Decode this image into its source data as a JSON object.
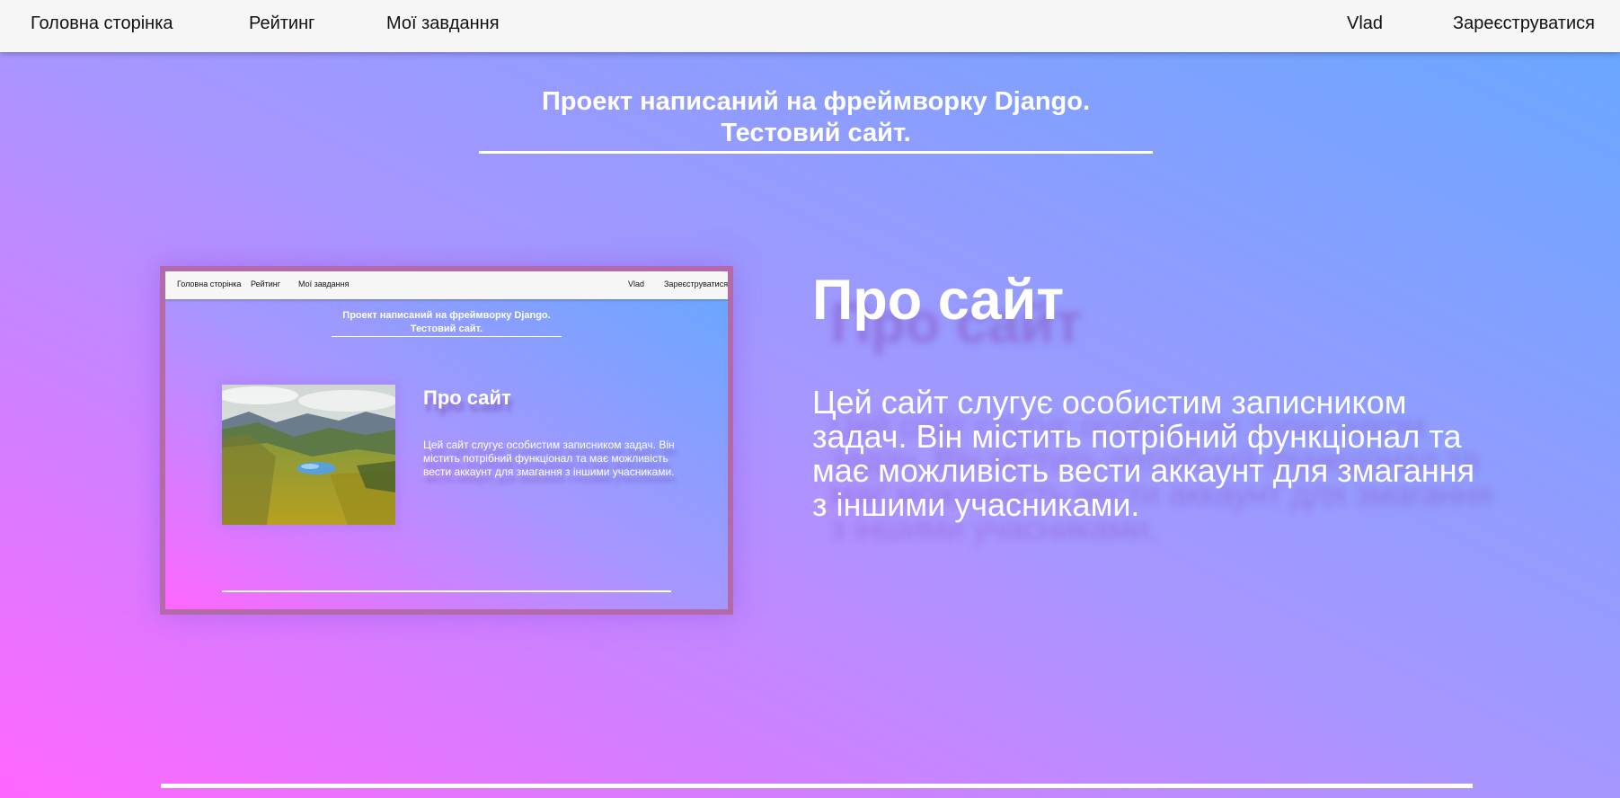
{
  "nav": {
    "home": "Головна сторінка",
    "rating": "Рейтинг",
    "tasks": "Мої завдання",
    "user": "Vlad",
    "register": "Зареєструватися"
  },
  "header": {
    "line1": "Проект написаний на фреймворку Django.",
    "line2": "Тестовий сайт."
  },
  "about": {
    "title": "Про сайт",
    "text": "Цей сайт слугує особистим записником задач. Він містить потрібний функціонал та має можливість вести аккаунт для змагання з іншими учасниками."
  },
  "preview": {
    "nav": {
      "home": "Головна сторінка",
      "rating": "Рейтинг",
      "tasks": "Мої завдання",
      "user": "Vlad",
      "register": "Зареєструватися"
    },
    "header": {
      "line1": "Проект написаний на фреймворку Django.",
      "line2": "Тестовий сайт."
    },
    "title": "Про сайт",
    "text": "Цей сайт слугує особистим записником задач. Він містить потрібний функціонал та має можливість вести аккаунт для змагання з іншими учасниками.",
    "image": "landscape-photo"
  },
  "colors": {
    "gradient_bottom_left": "#ff66ff",
    "gradient_mid": "#a796ff",
    "gradient_top_right": "#66a8ff",
    "navbar_bg": "#f6f6f6",
    "preview_border": "#b36aab"
  }
}
